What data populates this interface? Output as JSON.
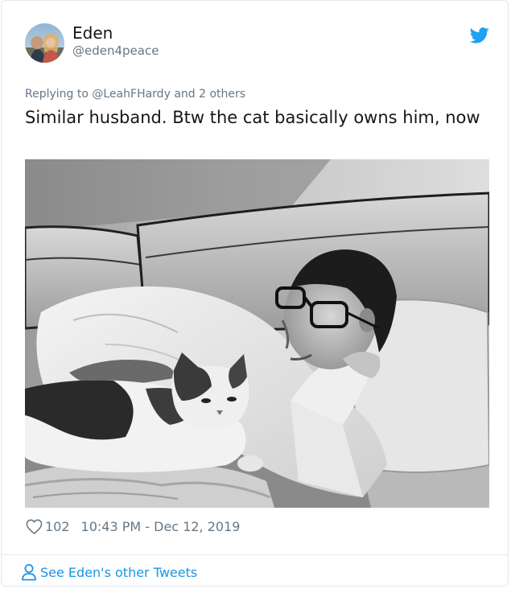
{
  "author": {
    "display_name": "Eden",
    "handle": "@eden4peace"
  },
  "reply_context": {
    "prefix": "Replying to",
    "mention": "@LeahFHardy",
    "suffix": "and 2 others"
  },
  "tweet": {
    "text": "Similar husband. Btw the cat basically owns him, now",
    "like_count": "102",
    "timestamp": "10:43 PM - Dec 12, 2019"
  },
  "footer": {
    "see_more_label": "See Eden's other Tweets"
  },
  "icons": {
    "brand": "twitter-bird-icon",
    "like": "heart-icon",
    "profile": "person-icon"
  },
  "colors": {
    "twitter_blue": "#1da1f2",
    "link_blue": "#1b95e0",
    "secondary_text": "#657786",
    "primary_text": "#14171a",
    "border": "#e1e8ed"
  }
}
